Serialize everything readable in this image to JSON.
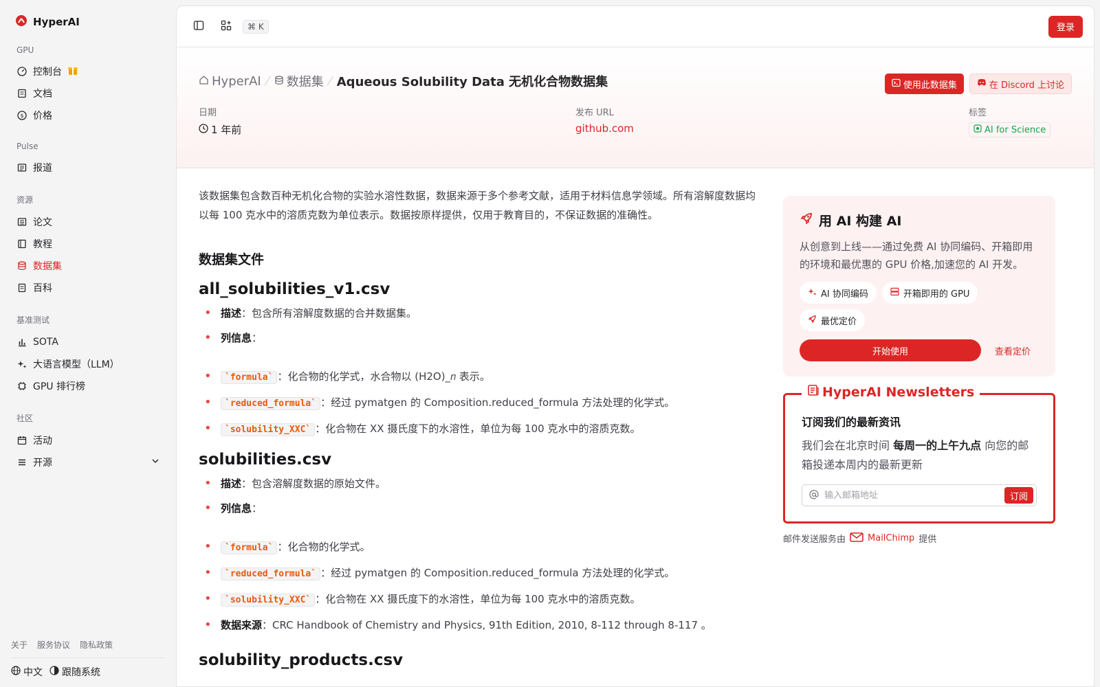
{
  "brand": {
    "name": "HyperAI",
    "accent": "#dc2626"
  },
  "sidebar": {
    "sections": [
      {
        "title": "GPU",
        "items": [
          {
            "label": "控制台",
            "icon": "gauge-icon"
          },
          {
            "label": "文档",
            "icon": "book-icon"
          },
          {
            "label": "价格",
            "icon": "dollar-icon"
          }
        ]
      },
      {
        "title": "Pulse",
        "items": [
          {
            "label": "报道",
            "icon": "newspaper-icon"
          }
        ]
      },
      {
        "title": "资源",
        "items": [
          {
            "label": "论文",
            "icon": "paper-icon"
          },
          {
            "label": "教程",
            "icon": "tutorial-icon"
          },
          {
            "label": "数据集",
            "icon": "database-icon",
            "active": true
          },
          {
            "label": "百科",
            "icon": "wiki-icon"
          }
        ]
      },
      {
        "title": "基准测试",
        "items": [
          {
            "label": "SOTA",
            "icon": "bar-chart-icon"
          },
          {
            "label": "大语言模型（LLM）",
            "icon": "sparkles-icon"
          },
          {
            "label": "GPU 排行榜",
            "icon": "chip-icon"
          }
        ]
      },
      {
        "title": "社区",
        "items": [
          {
            "label": "活动",
            "icon": "calendar-icon"
          },
          {
            "label": "开源",
            "icon": "list-icon"
          }
        ]
      }
    ],
    "footer_links": [
      "关于",
      "服务协议",
      "隐私政策"
    ],
    "language": "中文",
    "theme": "跟随系统"
  },
  "topbar": {
    "shortcut": "⌘ K",
    "login_label": "登录"
  },
  "hero": {
    "breadcrumb": [
      "HyperAI",
      "数据集",
      "Aqueous Solubility Data 无机化合物数据集"
    ],
    "use_dataset_label": "使用此数据集",
    "discord_label": "在 Discord 上讨论",
    "date_label": "日期",
    "date_value": "1 年前",
    "url_label": "发布 URL",
    "url_value": "github.com",
    "tag_label": "标签",
    "tag_value": "AI for Science"
  },
  "content": {
    "intro": "该数据集包含数百种无机化合物的实验水溶性数据，数据来源于多个参考文献，适用于材料信息学领域。所有溶解度数据均以每 100 克水中的溶质克数为单位表示。数据按原样提供，仅用于教育目的，不保证数据的准确性。",
    "files_heading": "数据集文件",
    "file1": {
      "name": "all_solubilities_v1.csv",
      "desc_key": "描述",
      "desc_val": "：包含所有溶解度数据的合并数据集。",
      "cols_key": "列信息",
      "cols_val": "：",
      "col1_code": "`formula`",
      "col1_text": "：化合物的化学式，水合物以 (H2O)_𝑛 表示。",
      "col2_code": "`reduced_formula`",
      "col2_text": "：经过 pymatgen 的 Composition.reduced_formula 方法处理的化学式。",
      "col3_code": "`solubility_XXC`",
      "col3_text": "：化合物在 XX 摄氏度下的水溶性，单位为每 100 克水中的溶质克数。"
    },
    "file2": {
      "name": "solubilities.csv",
      "desc_key": "描述",
      "desc_val": "：包含溶解度数据的原始文件。",
      "cols_key": "列信息",
      "cols_val": "：",
      "col1_code": "`formula`",
      "col1_text": "：化合物的化学式。",
      "col2_code": "`reduced_formula`",
      "col2_text": "：经过 pymatgen 的 Composition.reduced_formula 方法处理的化学式。",
      "col3_code": "`solubility_XXC`",
      "col3_text": "：化合物在 XX 摄氏度下的水溶性，单位为每 100 克水中的溶质克数。",
      "source_key": "数据来源",
      "source_val": "：CRC Handbook of Chemistry and Physics, 91th Edition, 2010, 8-112 through 8-117 。"
    },
    "file3": {
      "name": "solubility_products.csv"
    }
  },
  "promo": {
    "title": "用 AI 构建 AI",
    "desc": "从创意到上线——通过免费 AI 协同编码、开箱即用的环境和最优惠的 GPU 价格,加速您的 AI 开发。",
    "chips": [
      "AI 协同编码",
      "开箱即用的 GPU",
      "最优定价"
    ],
    "start_label": "开始使用",
    "pricing_label": "查看定价"
  },
  "newsletter": {
    "title": "HyperAI Newsletters",
    "heading": "订阅我们的最新资讯",
    "desc_pre": "我们会在北京时间 ",
    "desc_bold": "每周一的上午九点",
    "desc_post": " 向您的邮箱投递本周内的最新更新",
    "placeholder": "输入邮箱地址",
    "subscribe_label": "订阅",
    "provider_pre": "邮件发送服务由",
    "provider_name": "MailChimp",
    "provider_post": "提供"
  }
}
